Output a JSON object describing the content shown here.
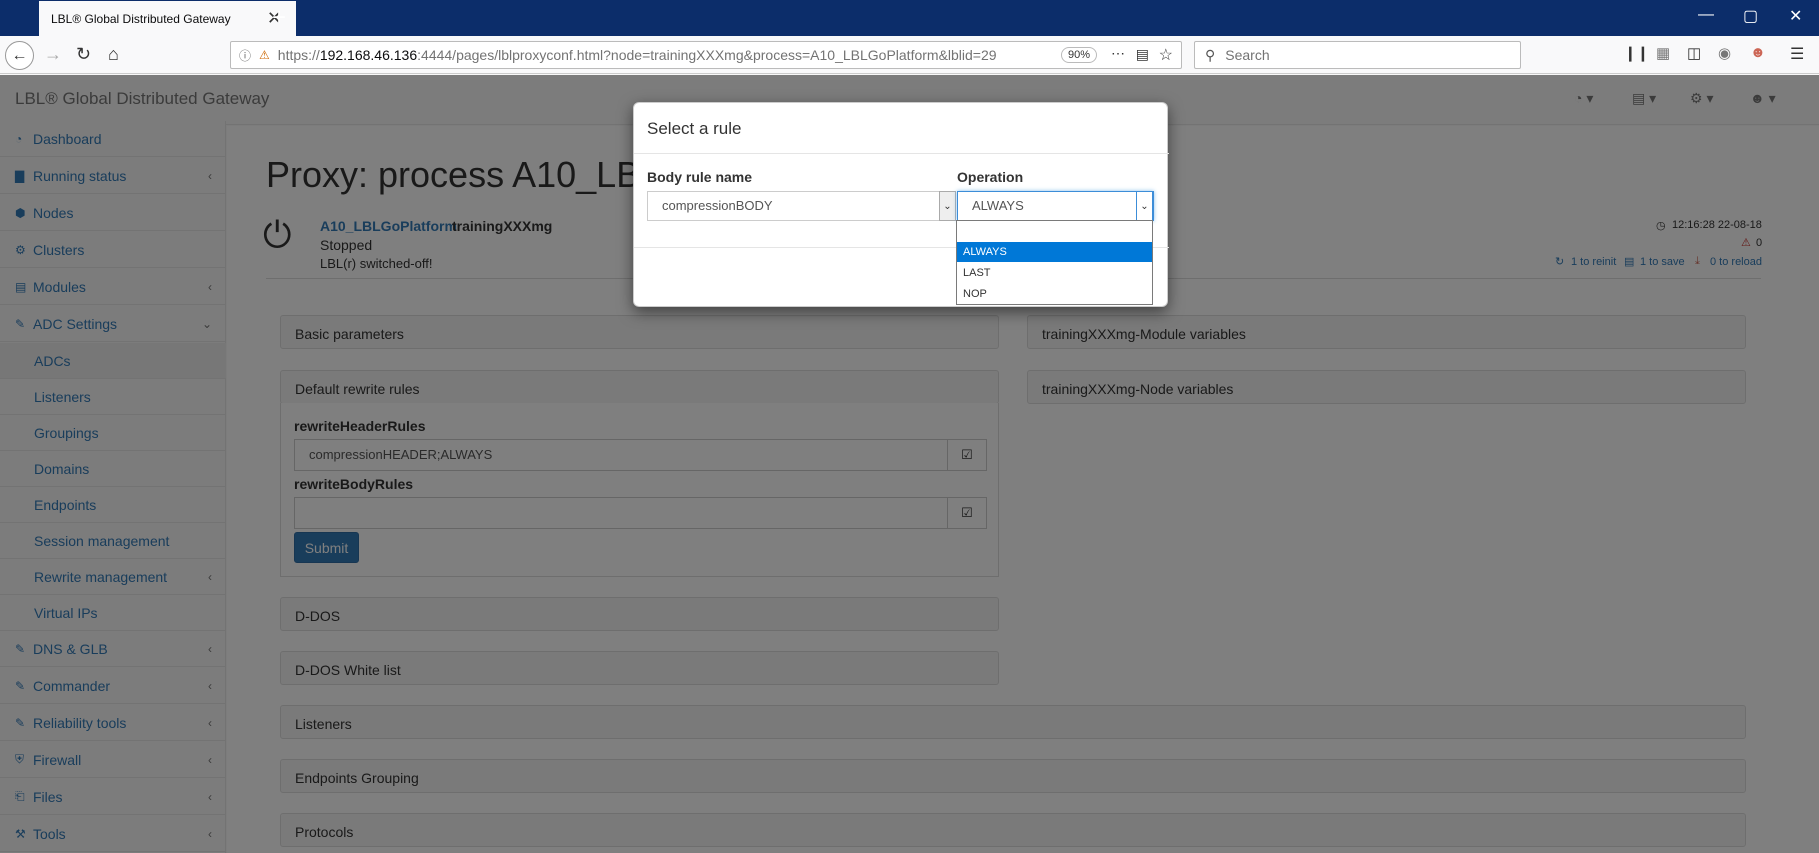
{
  "browser": {
    "tab_title": "LBL® Global Distributed Gateway",
    "tab_close": "✕",
    "new_tab": "+",
    "url_prefix": "https://",
    "url_host": "192.168.46.136",
    "url_rest": ":4444/pages/lblproxyconf.html?node=trainingXXXmg&process=A10_LBLGoPlatform&lblid=29",
    "zoom": "90%",
    "search_placeholder": "Search",
    "win_min": "—",
    "win_max": "▢",
    "win_close": "✕"
  },
  "app": {
    "brand": "LBL® Global Distributed Gateway"
  },
  "sidebar": {
    "items": [
      {
        "label": "Dashboard",
        "icon": "◔"
      },
      {
        "label": "Running status",
        "icon": "▇"
      },
      {
        "label": "Nodes",
        "icon": "⬢"
      },
      {
        "label": "Clusters",
        "icon": "⚙"
      },
      {
        "label": "Modules",
        "icon": "▤"
      },
      {
        "label": "ADC Settings",
        "icon": "✎"
      },
      {
        "label": "ADCs"
      },
      {
        "label": "Listeners"
      },
      {
        "label": "Groupings"
      },
      {
        "label": "Domains"
      },
      {
        "label": "Endpoints"
      },
      {
        "label": "Session management"
      },
      {
        "label": "Rewrite management"
      },
      {
        "label": "Virtual IPs"
      },
      {
        "label": "DNS & GLB",
        "icon": "✎"
      },
      {
        "label": "Commander",
        "icon": "✎"
      },
      {
        "label": "Reliability tools",
        "icon": "✎"
      },
      {
        "label": "Firewall",
        "icon": "⛨"
      },
      {
        "label": "Files",
        "icon": "⎗"
      },
      {
        "label": "Tools",
        "icon": "⚒"
      }
    ]
  },
  "main": {
    "title": "Proxy: process A10_LBLG",
    "process_link": "A10_LBLGoPlatform",
    "node": "trainingXXXmg",
    "status": "Stopped",
    "substatus": "LBL(r) switched-off!",
    "timestamp": "12:16:28 22-08-18",
    "alerts": "0",
    "reinit": "1 to reinit",
    "save": "1 to save",
    "reload": "0 to reload",
    "panels": {
      "basic": "Basic parameters",
      "default_rules": "Default rewrite rules",
      "ddos": "D-DOS",
      "ddos_white": "D-DOS White list",
      "listeners": "Listeners",
      "endpoints_grouping": "Endpoints Grouping",
      "protocols": "Protocols",
      "module_vars": "trainingXXXmg-Module variables",
      "node_vars": "trainingXXXmg-Node variables"
    },
    "form": {
      "header_label": "rewriteHeaderRules",
      "header_value": "compressionHEADER;ALWAYS",
      "body_label": "rewriteBodyRules",
      "body_value": "",
      "submit": "Submit"
    }
  },
  "modal": {
    "title": "Select a rule",
    "body_rule_label": "Body rule name",
    "body_rule_value": "compressionBODY",
    "operation_label": "Operation",
    "operation_value": "ALWAYS",
    "options": [
      "ALWAYS",
      "LAST",
      "NOP"
    ]
  }
}
